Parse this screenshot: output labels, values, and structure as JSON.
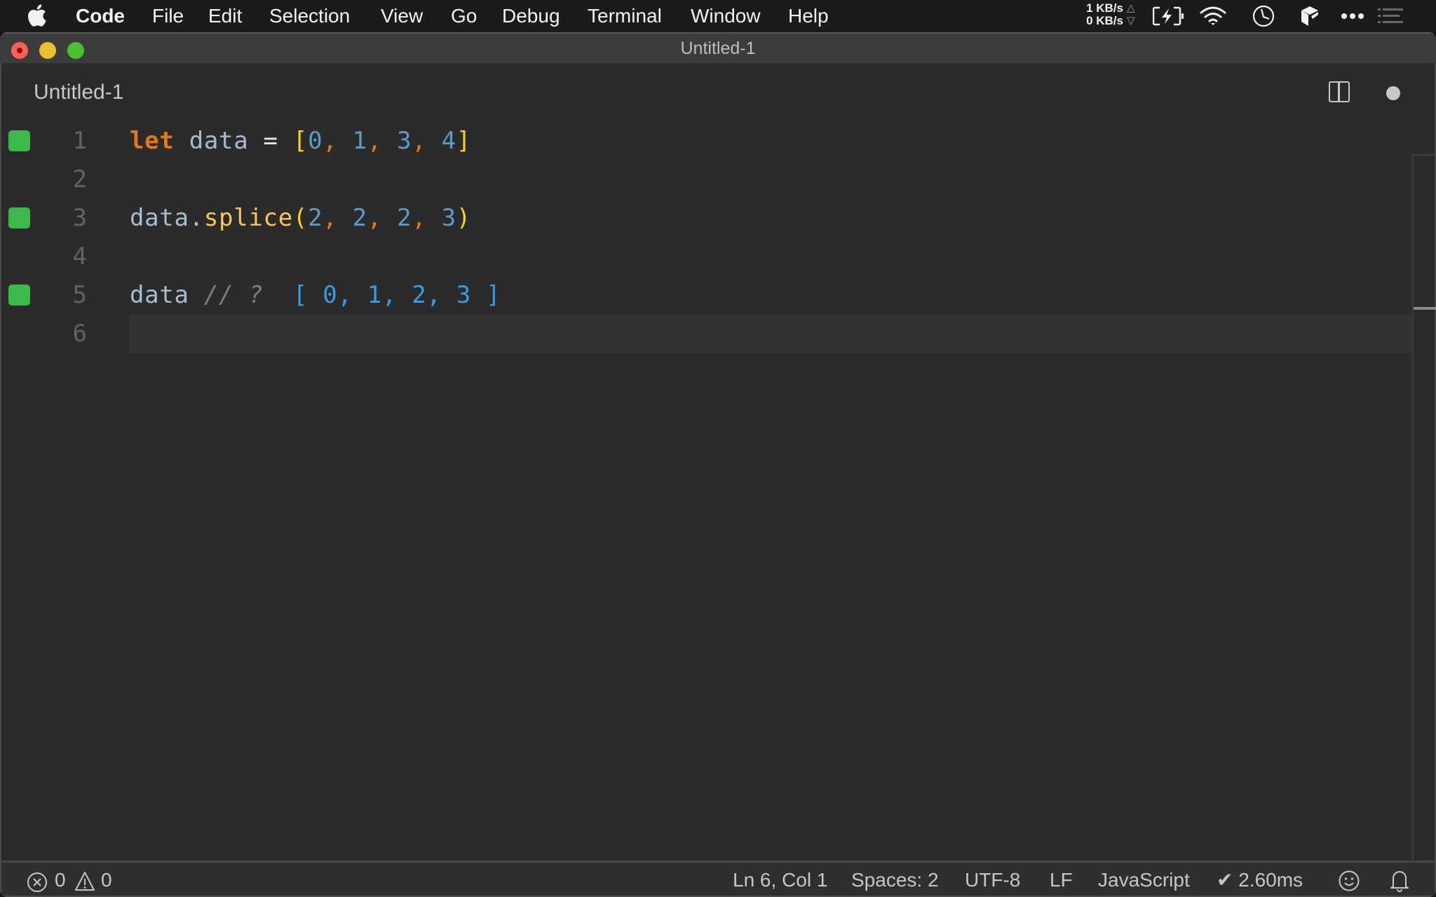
{
  "menubar": {
    "apple_icon": "apple-logo",
    "items": [
      {
        "label": "Code",
        "bold": true
      },
      {
        "label": "File"
      },
      {
        "label": "Edit"
      },
      {
        "label": "Selection"
      },
      {
        "label": "View"
      },
      {
        "label": "Go"
      },
      {
        "label": "Debug"
      },
      {
        "label": "Terminal"
      },
      {
        "label": "Window"
      },
      {
        "label": "Help"
      }
    ],
    "tray": {
      "net_up": "1 KB/s",
      "net_down": "0 KB/s",
      "net_up_arrow": "△",
      "net_down_arrow": "▽",
      "icons": [
        "battery-charging-icon",
        "wifi-icon",
        "clock-icon",
        "app-cube-icon",
        "more-icon",
        "list-icon"
      ]
    }
  },
  "window": {
    "title": "Untitled-1",
    "tab": {
      "label": "Untitled-1",
      "dirty": true
    },
    "editor": {
      "current_line": 6,
      "lines": [
        {
          "number": "1",
          "marker": true,
          "tokens": [
            {
              "t": "let",
              "c": "keyword"
            },
            {
              "t": " ",
              "c": "ident"
            },
            {
              "t": "data",
              "c": "ident"
            },
            {
              "t": " = ",
              "c": "op"
            },
            {
              "t": "[",
              "c": "bracket"
            },
            {
              "t": "0",
              "c": "number"
            },
            {
              "t": ",",
              "c": "comma"
            },
            {
              "t": " ",
              "c": "op"
            },
            {
              "t": "1",
              "c": "number"
            },
            {
              "t": ",",
              "c": "comma"
            },
            {
              "t": " ",
              "c": "op"
            },
            {
              "t": "3",
              "c": "number"
            },
            {
              "t": ",",
              "c": "comma"
            },
            {
              "t": " ",
              "c": "op"
            },
            {
              "t": "4",
              "c": "number"
            },
            {
              "t": "]",
              "c": "bracket"
            }
          ]
        },
        {
          "number": "2",
          "marker": false,
          "tokens": []
        },
        {
          "number": "3",
          "marker": true,
          "tokens": [
            {
              "t": "data",
              "c": "ident"
            },
            {
              "t": ".",
              "c": "ident"
            },
            {
              "t": "splice",
              "c": "func"
            },
            {
              "t": "(",
              "c": "bracket"
            },
            {
              "t": "2",
              "c": "number"
            },
            {
              "t": ",",
              "c": "comma"
            },
            {
              "t": " ",
              "c": "op"
            },
            {
              "t": "2",
              "c": "number"
            },
            {
              "t": ",",
              "c": "comma"
            },
            {
              "t": " ",
              "c": "op"
            },
            {
              "t": "2",
              "c": "number"
            },
            {
              "t": ",",
              "c": "comma"
            },
            {
              "t": " ",
              "c": "op"
            },
            {
              "t": "3",
              "c": "number"
            },
            {
              "t": ")",
              "c": "bracket"
            }
          ]
        },
        {
          "number": "4",
          "marker": false,
          "tokens": []
        },
        {
          "number": "5",
          "marker": true,
          "tokens": [
            {
              "t": "data",
              "c": "ident"
            },
            {
              "t": " ",
              "c": "op"
            },
            {
              "t": "// ?",
              "c": "comment"
            },
            {
              "t": "  ",
              "c": "op"
            },
            {
              "t": "[ 0, 1, 2, 3 ]",
              "c": "result"
            }
          ]
        },
        {
          "number": "6",
          "marker": false,
          "tokens": []
        }
      ]
    },
    "statusbar": {
      "errors": "0",
      "warnings": "0",
      "cursor": "Ln 6, Col 1",
      "indent": "Spaces: 2",
      "encoding": "UTF-8",
      "eol": "LF",
      "language": "JavaScript",
      "timing": "✔ 2.60ms"
    }
  },
  "colors": {
    "marker_green": "#3cb94a",
    "keyword": "#e2781d",
    "identifier": "#a7bccf",
    "number": "#5b9bc8",
    "bracket": "#fcd116",
    "function": "#fcc45a",
    "comment": "#7d7d7d",
    "result": "#3a9be0"
  }
}
